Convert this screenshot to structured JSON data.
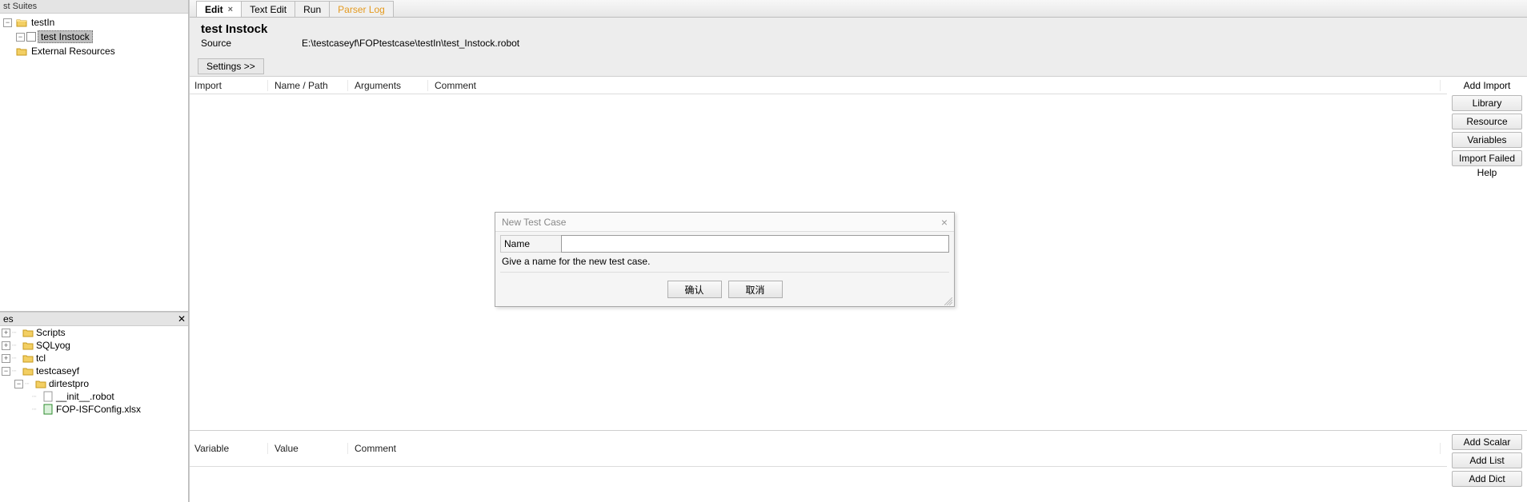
{
  "suites_panel": {
    "title": "st Suites",
    "tree": {
      "root": "testIn",
      "child": "test Instock",
      "external": "External Resources"
    }
  },
  "files_panel": {
    "title": "es",
    "items": {
      "scripts": "Scripts",
      "sqlyog": "SQLyog",
      "tcl": "tcl",
      "testcaseyf": "testcaseyf",
      "dirtestpro": "dirtestpro",
      "init": "__init__.robot",
      "fopconfig": "FOP-ISFConfig.xlsx"
    }
  },
  "tabs": {
    "edit": "Edit",
    "textedit": "Text Edit",
    "run": "Run",
    "parserlog": "Parser Log"
  },
  "page": {
    "title": "test Instock",
    "source_label": "Source",
    "source_value": "E:\\testcaseyf\\FOPtestcase\\testIn\\test_Instock.robot",
    "settings_btn": "Settings >>"
  },
  "imports_grid": {
    "col_import": "Import",
    "col_namepath": "Name / Path",
    "col_args": "Arguments",
    "col_comment": "Comment"
  },
  "import_buttons": {
    "caption": "Add Import",
    "library": "Library",
    "resource": "Resource",
    "variables": "Variables",
    "failedhelp": "Import Failed Help"
  },
  "vars_grid": {
    "col_variable": "Variable",
    "col_value": "Value",
    "col_comment": "Comment"
  },
  "var_buttons": {
    "scalar": "Add Scalar",
    "list": "Add List",
    "dict": "Add Dict"
  },
  "dialog": {
    "title": "New Test Case",
    "name_label": "Name",
    "name_value": "",
    "hint": "Give a name for the new test case.",
    "ok": "确认",
    "cancel": "取消"
  }
}
